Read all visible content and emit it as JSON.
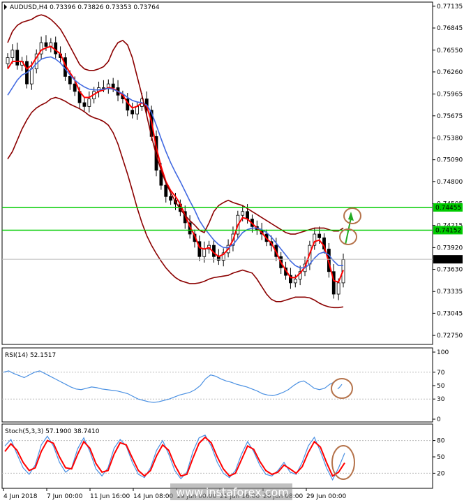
{
  "chart_data": [
    {
      "type": "candlestick",
      "title": "AUDUSD,H4  0.73396 0.73826 0.73353 0.73764",
      "y_ticks": [
        "0.77135",
        "0.76845",
        "0.76550",
        "0.76260",
        "0.75965",
        "0.75675",
        "0.75380",
        "0.75090",
        "0.74800",
        "0.74505",
        "0.74215",
        "0.73920",
        "0.73630",
        "0.73335",
        "0.73045",
        "0.72750"
      ],
      "ylim": [
        0.7263,
        0.7719
      ],
      "x_ticks": [
        "4 Jun 2018",
        "7 Jun 00:00",
        "11 Jun 16:00",
        "14 Jun 08:00",
        "19 Jun 00:00",
        "21 Jun 16:00",
        "26 Jun 08:00",
        "29 Jun 00:00"
      ],
      "levels": [
        {
          "value": 0.74455,
          "label": "0.74455",
          "color": "#00cc00"
        },
        {
          "value": 0.74152,
          "label": "0.74152",
          "color": "#00cc00"
        }
      ],
      "current_price": {
        "value": 0.73764,
        "label": "0.73764"
      },
      "series": [
        {
          "name": "close",
          "values": [
            0.7645,
            0.7655,
            0.7635,
            0.764,
            0.761,
            0.763,
            0.765,
            0.7665,
            0.766,
            0.7665,
            0.765,
            0.7645,
            0.762,
            0.761,
            0.76,
            0.7585,
            0.758,
            0.759,
            0.76,
            0.7605,
            0.7605,
            0.761,
            0.7605,
            0.7595,
            0.759,
            0.7575,
            0.757,
            0.758,
            0.759,
            0.7575,
            0.754,
            0.7495,
            0.7475,
            0.746,
            0.7455,
            0.745,
            0.744,
            0.7425,
            0.741,
            0.74,
            0.738,
            0.739,
            0.7395,
            0.738,
            0.7375,
            0.7385,
            0.7395,
            0.741,
            0.7435,
            0.744,
            0.743,
            0.742,
            0.7415,
            0.741,
            0.74,
            0.7395,
            0.738,
            0.7365,
            0.7355,
            0.7345,
            0.735,
            0.736,
            0.737,
            0.7395,
            0.741,
            0.7405,
            0.739,
            0.736,
            0.733,
            0.7345,
            0.7376
          ]
        },
        {
          "name": "ma_fast",
          "color": "#ff0000",
          "values": [
            0.763,
            0.764,
            0.764,
            0.764,
            0.763,
            0.7635,
            0.7645,
            0.7655,
            0.7658,
            0.766,
            0.7655,
            0.765,
            0.7635,
            0.7625,
            0.7615,
            0.76,
            0.7592,
            0.7592,
            0.7596,
            0.76,
            0.7602,
            0.7605,
            0.7604,
            0.76,
            0.7595,
            0.7585,
            0.7578,
            0.758,
            0.7585,
            0.758,
            0.756,
            0.7525,
            0.75,
            0.748,
            0.7468,
            0.746,
            0.745,
            0.7435,
            0.742,
            0.7408,
            0.7392,
            0.739,
            0.7392,
            0.7385,
            0.738,
            0.7383,
            0.739,
            0.7402,
            0.7422,
            0.7432,
            0.743,
            0.7424,
            0.7418,
            0.7412,
            0.7404,
            0.7398,
            0.7386,
            0.7372,
            0.7362,
            0.7352,
            0.7352,
            0.7358,
            0.7366,
            0.7384,
            0.74,
            0.7402,
            0.7394,
            0.7372,
            0.7348,
            0.7346,
            0.7362
          ]
        },
        {
          "name": "ma_mid",
          "color": "#4169e1",
          "values": [
            0.7595,
            0.7605,
            0.7615,
            0.7622,
            0.7625,
            0.763,
            0.7637,
            0.7643,
            0.7645,
            0.7646,
            0.7643,
            0.7638,
            0.763,
            0.7622,
            0.7615,
            0.761,
            0.7606,
            0.7603,
            0.7602,
            0.7602,
            0.7603,
            0.7604,
            0.7603,
            0.76,
            0.7597,
            0.7592,
            0.7588,
            0.7586,
            0.7585,
            0.7582,
            0.7572,
            0.7555,
            0.7537,
            0.752,
            0.7505,
            0.7492,
            0.748,
            0.7467,
            0.7454,
            0.7442,
            0.7428,
            0.7418,
            0.741,
            0.7402,
            0.7396,
            0.7392,
            0.7392,
            0.7396,
            0.7404,
            0.7412,
            0.7416,
            0.7418,
            0.7418,
            0.7416,
            0.7412,
            0.7406,
            0.7398,
            0.739,
            0.7382,
            0.7374,
            0.7368,
            0.7365,
            0.7365,
            0.737,
            0.7378,
            0.7384,
            0.7386,
            0.7382,
            0.7374,
            0.7368,
            0.7368
          ]
        },
        {
          "name": "band_upper",
          "color": "#8b0000",
          "values": [
            0.7665,
            0.768,
            0.7688,
            0.7692,
            0.7694,
            0.7696,
            0.77,
            0.7702,
            0.77,
            0.7696,
            0.769,
            0.7683,
            0.7672,
            0.766,
            0.7648,
            0.7636,
            0.763,
            0.7628,
            0.7628,
            0.763,
            0.7633,
            0.764,
            0.7655,
            0.7665,
            0.7668,
            0.7662,
            0.7645,
            0.762,
            0.7595,
            0.7568,
            0.754,
            0.7515,
            0.7495,
            0.7478,
            0.7465,
            0.7453,
            0.7443,
            0.7435,
            0.7428,
            0.7422,
            0.7415,
            0.7412,
            0.7425,
            0.744,
            0.7448,
            0.7452,
            0.7455,
            0.7452,
            0.745,
            0.7448,
            0.7444,
            0.744,
            0.7436,
            0.7432,
            0.7428,
            0.7424,
            0.742,
            0.7416,
            0.7412,
            0.741,
            0.741,
            0.7412,
            0.7414,
            0.7416,
            0.7418,
            0.7418,
            0.7418,
            0.7416,
            0.7414,
            0.7414,
            0.7418
          ]
        },
        {
          "name": "band_lower",
          "color": "#8b0000",
          "values": [
            0.751,
            0.752,
            0.7535,
            0.755,
            0.7562,
            0.7572,
            0.7578,
            0.7582,
            0.7585,
            0.759,
            0.7592,
            0.759,
            0.7587,
            0.7583,
            0.758,
            0.7577,
            0.7573,
            0.7568,
            0.7565,
            0.7563,
            0.756,
            0.7555,
            0.7545,
            0.753,
            0.751,
            0.749,
            0.7468,
            0.7445,
            0.7425,
            0.7408,
            0.7395,
            0.7384,
            0.7374,
            0.7365,
            0.7358,
            0.7352,
            0.7348,
            0.7346,
            0.7344,
            0.7344,
            0.7345,
            0.7347,
            0.735,
            0.7352,
            0.7353,
            0.7354,
            0.7355,
            0.7358,
            0.736,
            0.7362,
            0.736,
            0.7358,
            0.735,
            0.734,
            0.733,
            0.7323,
            0.732,
            0.732,
            0.7322,
            0.7324,
            0.7326,
            0.7326,
            0.7326,
            0.7325,
            0.7322,
            0.7318,
            0.7315,
            0.7313,
            0.7312,
            0.7312,
            0.7313
          ]
        }
      ]
    },
    {
      "type": "line",
      "title": "RSI(14) 52.1517",
      "y_ticks": [
        "100",
        "70",
        "50",
        "30",
        "0"
      ],
      "ylim": [
        0,
        100
      ],
      "levels": [
        70,
        30
      ],
      "series": [
        {
          "name": "RSI",
          "color": "#4a90e2",
          "values": [
            70,
            72,
            68,
            65,
            62,
            66,
            70,
            72,
            68,
            64,
            60,
            56,
            52,
            48,
            45,
            44,
            46,
            48,
            47,
            45,
            44,
            43,
            42,
            40,
            38,
            34,
            30,
            28,
            26,
            25,
            26,
            28,
            30,
            33,
            36,
            38,
            40,
            44,
            50,
            60,
            66,
            64,
            60,
            57,
            55,
            52,
            50,
            48,
            45,
            42,
            38,
            36,
            35,
            37,
            40,
            44,
            50,
            55,
            57,
            52,
            46,
            44,
            46,
            52,
            56
          ]
        },
        {
          "name": "RSI_signal",
          "color": "#4a90e2",
          "values": [
            45,
            48,
            52
          ]
        }
      ]
    },
    {
      "type": "line",
      "title": "Stoch(5,3,3) 57.1900 38.7410",
      "y_ticks": [
        "80",
        "50",
        "20"
      ],
      "ylim": [
        0,
        100
      ],
      "levels": [
        80,
        20
      ],
      "series": [
        {
          "name": "%K",
          "color": "#4a90e2",
          "values": [
            70,
            82,
            55,
            30,
            18,
            35,
            72,
            88,
            70,
            40,
            22,
            30,
            65,
            85,
            60,
            28,
            15,
            30,
            66,
            82,
            70,
            40,
            18,
            12,
            30,
            62,
            80,
            55,
            25,
            10,
            22,
            60,
            85,
            90,
            70,
            40,
            20,
            12,
            25,
            55,
            78,
            60,
            35,
            18,
            15,
            25,
            40,
            22,
            18,
            40,
            70,
            86,
            60,
            30,
            8,
            30,
            57
          ]
        },
        {
          "name": "%D",
          "color": "#ff0000",
          "values": [
            60,
            74,
            62,
            40,
            25,
            30,
            60,
            80,
            75,
            50,
            30,
            28,
            55,
            78,
            66,
            38,
            22,
            25,
            55,
            76,
            72,
            48,
            25,
            15,
            25,
            52,
            72,
            62,
            35,
            15,
            18,
            48,
            75,
            86,
            76,
            50,
            28,
            15,
            20,
            45,
            70,
            64,
            42,
            25,
            18,
            22,
            35,
            28,
            20,
            32,
            58,
            78,
            68,
            40,
            15,
            22,
            39
          ]
        }
      ]
    }
  ],
  "watermark": "www.instaforex.com"
}
